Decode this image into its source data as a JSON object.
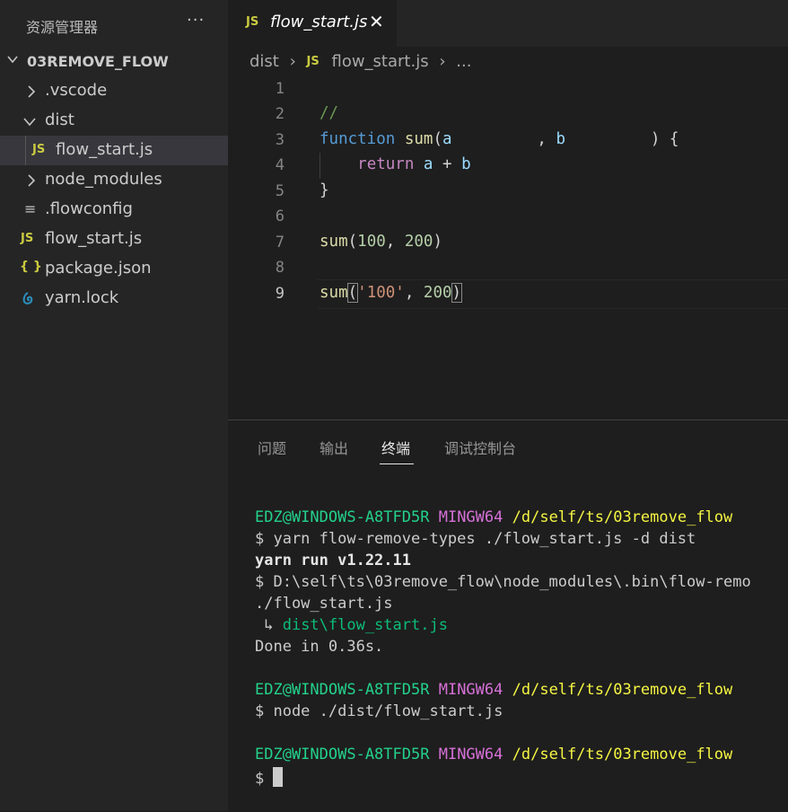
{
  "explorer": {
    "title": "资源管理器",
    "more": "···",
    "root": "03REMOVE_FLOW",
    "items": [
      {
        "label": ".vscode",
        "icon": "chevron-right-icon"
      },
      {
        "label": "dist",
        "icon": "chevron-down-icon"
      },
      {
        "label": "flow_start.js",
        "icon_text": "JS"
      },
      {
        "label": "node_modules",
        "icon": "chevron-right-icon"
      },
      {
        "label": ".flowconfig",
        "icon_text": "≡"
      },
      {
        "label": "flow_start.js",
        "icon_text": "JS"
      },
      {
        "label": "package.json",
        "icon_text": "{ }"
      },
      {
        "label": "yarn.lock",
        "icon": "yarn-icon"
      }
    ]
  },
  "tab": {
    "icon_text": "JS",
    "label": "flow_start.js",
    "close": "✕"
  },
  "breadcrumb": {
    "folder": "dist",
    "sep": "›",
    "icon_text": "JS",
    "file": "flow_start.js",
    "more": "..."
  },
  "editor": {
    "line_numbers": [
      "1",
      "2",
      "3",
      "4",
      "5",
      "6",
      "7",
      "8",
      "9"
    ],
    "active_line": 9
  },
  "panel": {
    "tabs": [
      "问题",
      "输出",
      "终端",
      "调试控制台"
    ],
    "active_tab": "终端"
  },
  "terminal": {
    "user": "EDZ@WINDOWS-A8TFD5R",
    "env": "MINGW64",
    "path": "/d/self/ts/03remove_flow",
    "cmd1": "$ yarn flow-remove-types ./flow_start.js -d dist",
    "yarn_run": "yarn run v1.22.11",
    "exec_line": "$ D:\\self\\ts\\03remove_flow\\node_modules\\.bin\\flow-remo",
    "exec_cont": "./flow_start.js",
    "arrow": " ↳ ",
    "output_file": "dist\\flow_start.js",
    "done": "Done in 0.36s.",
    "cmd2": "$ node ./dist/flow_start.js",
    "prompt": "$ "
  },
  "colors": {
    "accent_js": "#cbcb41",
    "terminal_green": "#23d18b",
    "terminal_magenta": "#d670d6",
    "terminal_yellow": "#f5f543"
  }
}
